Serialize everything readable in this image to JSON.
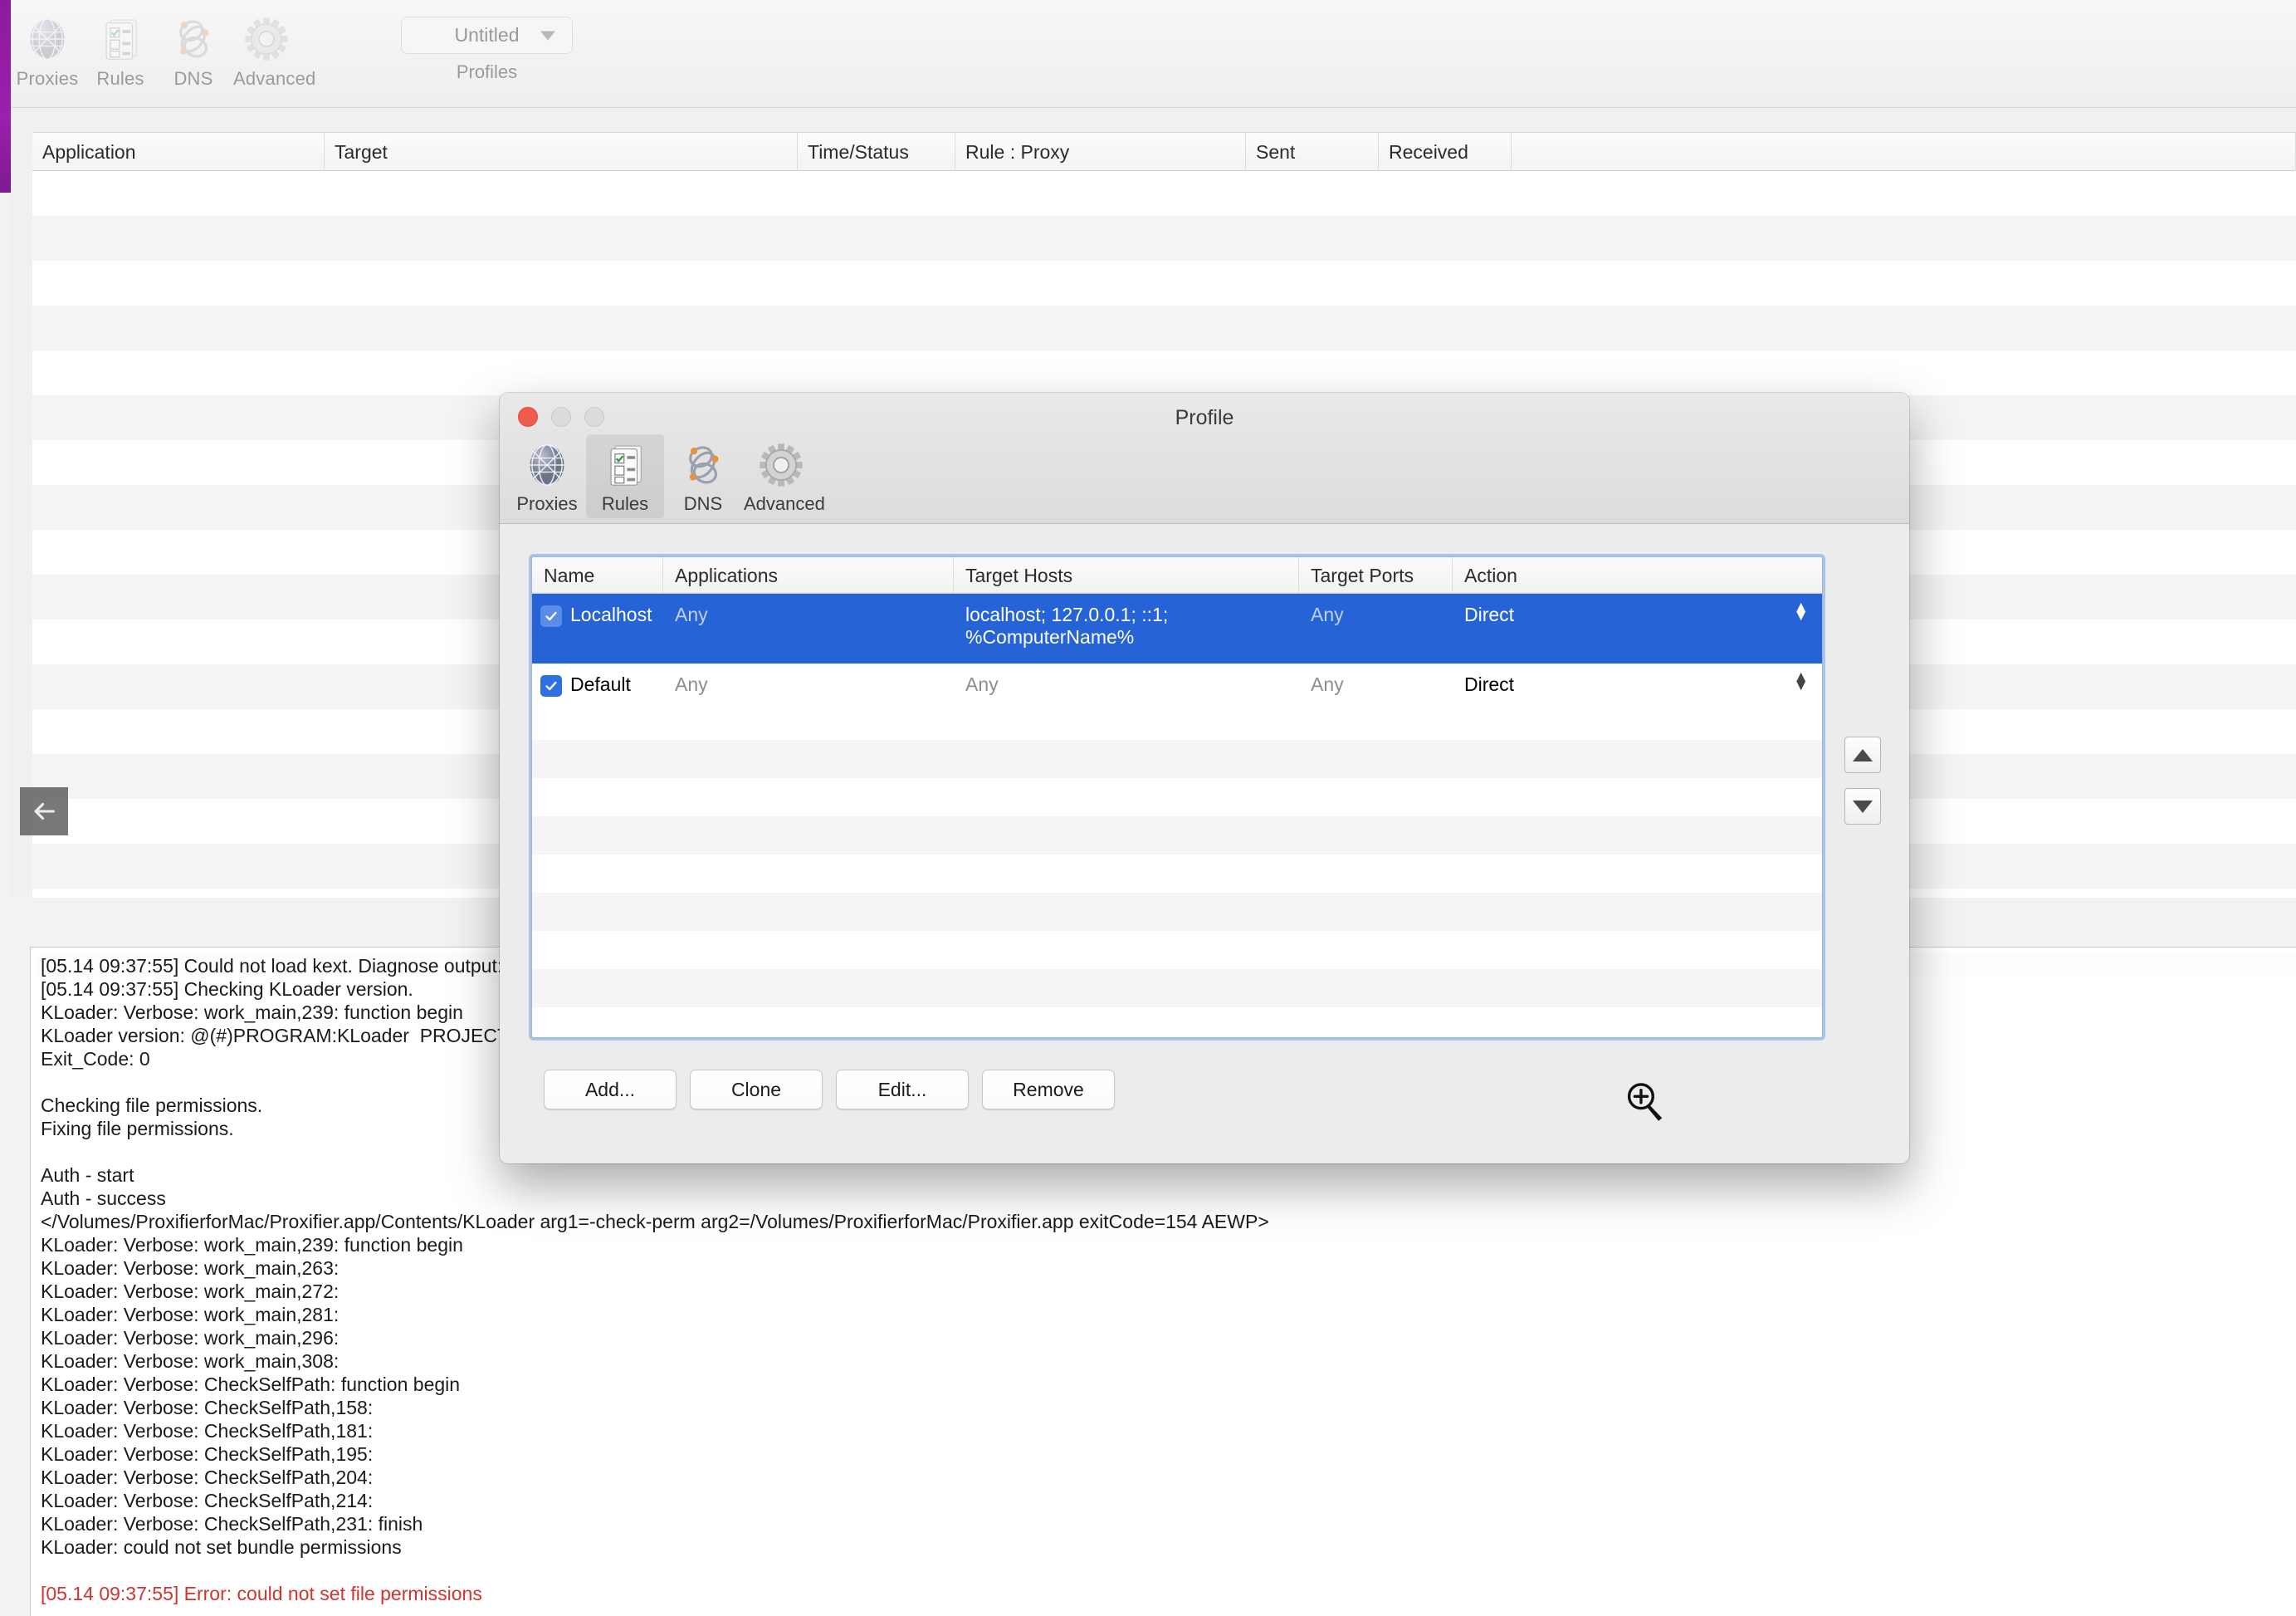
{
  "main_window": {
    "toolbar": {
      "items": [
        {
          "label": "Proxies",
          "icon": "globe-icon"
        },
        {
          "label": "Rules",
          "icon": "rules-list-icon"
        },
        {
          "label": "DNS",
          "icon": "dns-atom-icon"
        },
        {
          "label": "Advanced",
          "icon": "gear-icon"
        }
      ],
      "profiles": {
        "value": "Untitled",
        "label": "Profiles",
        "caret_icon": "chevron-down-icon"
      }
    },
    "connections_table": {
      "columns": [
        "Application",
        "Target",
        "Time/Status",
        "Rule : Proxy",
        "Sent",
        "Received"
      ],
      "rows": []
    },
    "back_button": {
      "icon": "arrow-left-icon"
    },
    "log": {
      "lines": [
        {
          "text": "[05.14 09:37:55] Could not load kext. Diagnose output:",
          "style": "selected"
        },
        {
          "text": "[05.14 09:37:55] Checking KLoader version.",
          "style": "normal"
        },
        {
          "text": "KLoader: Verbose: work_main,239: function begin",
          "style": "normal"
        },
        {
          "text": "KLoader version: @(#)PROGRAM:KLoader  PROJECT:",
          "style": "normal"
        },
        {
          "text": "Exit_Code: 0",
          "style": "normal"
        },
        {
          "text": "",
          "style": "blank"
        },
        {
          "text": "Checking file permissions.",
          "style": "normal"
        },
        {
          "text": "Fixing file permissions.",
          "style": "normal"
        },
        {
          "text": "",
          "style": "blank"
        },
        {
          "text": "Auth - start",
          "style": "normal"
        },
        {
          "text": "Auth - success",
          "style": "normal"
        },
        {
          "text": "</Volumes/ProxifierforMac/Proxifier.app/Contents/KLoader arg1=-check-perm arg2=/Volumes/ProxifierforMac/Proxifier.app exitCode=154 AEWP>",
          "style": "normal"
        },
        {
          "text": "KLoader: Verbose: work_main,239: function begin",
          "style": "normal"
        },
        {
          "text": "KLoader: Verbose: work_main,263:",
          "style": "normal"
        },
        {
          "text": "KLoader: Verbose: work_main,272:",
          "style": "normal"
        },
        {
          "text": "KLoader: Verbose: work_main,281:",
          "style": "normal"
        },
        {
          "text": "KLoader: Verbose: work_main,296:",
          "style": "normal"
        },
        {
          "text": "KLoader: Verbose: work_main,308:",
          "style": "normal"
        },
        {
          "text": "KLoader: Verbose: CheckSelfPath: function begin",
          "style": "normal"
        },
        {
          "text": "KLoader: Verbose: CheckSelfPath,158:",
          "style": "normal"
        },
        {
          "text": "KLoader: Verbose: CheckSelfPath,181:",
          "style": "normal"
        },
        {
          "text": "KLoader: Verbose: CheckSelfPath,195:",
          "style": "normal"
        },
        {
          "text": "KLoader: Verbose: CheckSelfPath,204:",
          "style": "normal"
        },
        {
          "text": "KLoader: Verbose: CheckSelfPath,214:",
          "style": "normal"
        },
        {
          "text": "KLoader: Verbose: CheckSelfPath,231: finish",
          "style": "normal"
        },
        {
          "text": "KLoader: could not set bundle permissions",
          "style": "normal"
        },
        {
          "text": "",
          "style": "blank"
        },
        {
          "text": "[05.14 09:37:55] Error: could not set file permissions",
          "style": "error"
        }
      ]
    }
  },
  "dialog": {
    "title": "Profile",
    "window_controls": {
      "close": "close-button",
      "minimize": "minimize-button",
      "zoom": "zoom-button"
    },
    "tabs": [
      {
        "label": "Proxies",
        "icon": "globe-icon",
        "active": false
      },
      {
        "label": "Rules",
        "icon": "rules-list-icon",
        "active": true
      },
      {
        "label": "DNS",
        "icon": "dns-atom-icon",
        "active": false
      },
      {
        "label": "Advanced",
        "icon": "gear-icon",
        "active": false
      }
    ],
    "rules_table": {
      "columns": [
        "Name",
        "Applications",
        "Target Hosts",
        "Target Ports",
        "Action"
      ],
      "rows": [
        {
          "checked": true,
          "name": "Localhost",
          "applications": "Any",
          "applications_muted": true,
          "target_hosts": "localhost; 127.0.0.1; ::1; %ComputerName%",
          "target_hosts_muted": false,
          "target_ports": "Any",
          "target_ports_muted": true,
          "action": "Direct",
          "selected": true
        },
        {
          "checked": true,
          "name": "Default",
          "applications": "Any",
          "applications_muted": true,
          "target_hosts": "Any",
          "target_hosts_muted": true,
          "target_ports": "Any",
          "target_ports_muted": true,
          "action": "Direct",
          "selected": false
        }
      ]
    },
    "reorder": {
      "up": "move-up-button",
      "down": "move-down-button"
    },
    "buttons": [
      {
        "label": "Add...",
        "name": "add-button"
      },
      {
        "label": "Clone",
        "name": "clone-button"
      },
      {
        "label": "Edit...",
        "name": "edit-button"
      },
      {
        "label": "Remove",
        "name": "remove-button"
      }
    ]
  },
  "cursor": {
    "icon": "zoom-in-cursor"
  },
  "colors": {
    "selection_blue": "#2563d6",
    "accent_purple": "#9c1fae",
    "error_red": "#d0342c",
    "focus_ring": "#9fb6e0"
  }
}
